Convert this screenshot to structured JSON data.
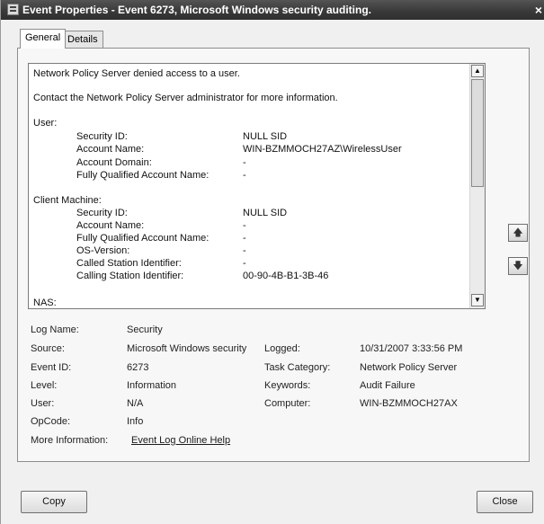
{
  "window": {
    "title": "Event Properties - Event 6273, Microsoft Windows security auditing.",
    "close_glyph": "×"
  },
  "tabs": [
    {
      "label": "General",
      "active": true
    },
    {
      "label": "Details",
      "active": false
    }
  ],
  "description": {
    "summary": "Network Policy Server denied access to a user.",
    "contact": "Contact the Network Policy Server administrator for more information.",
    "sections": [
      {
        "heading": "User:",
        "fields": [
          {
            "label": "Security ID:",
            "value": "NULL SID"
          },
          {
            "label": "Account Name:",
            "value": "WIN-BZMMOCH27AZ\\WirelessUser"
          },
          {
            "label": "Account Domain:",
            "value": "-"
          },
          {
            "label": "Fully Qualified Account Name:",
            "value": "-"
          }
        ]
      },
      {
        "heading": "Client Machine:",
        "fields": [
          {
            "label": "Security ID:",
            "value": "NULL SID"
          },
          {
            "label": "Account Name:",
            "value": "-"
          },
          {
            "label": "Fully Qualified Account Name:",
            "value": "-"
          },
          {
            "label": "OS-Version:",
            "value": "-"
          },
          {
            "label": "Called Station Identifier:",
            "value": "-"
          },
          {
            "label": "Calling Station Identifier:",
            "value": "00-90-4B-B1-3B-46"
          }
        ]
      },
      {
        "heading": "NAS:",
        "fields": []
      }
    ]
  },
  "scrollbar": {
    "up_glyph": "▲",
    "down_glyph": "▼"
  },
  "side_buttons": {
    "up_glyph": "🡅",
    "down_glyph": "🡇"
  },
  "properties": {
    "log_name": {
      "label": "Log Name:",
      "value": "Security"
    },
    "source": {
      "label": "Source:",
      "value": "Microsoft Windows security"
    },
    "logged": {
      "label": "Logged:",
      "value": "10/31/2007 3:33:56 PM"
    },
    "event_id": {
      "label": "Event ID:",
      "value": "6273"
    },
    "task_category": {
      "label": "Task Category:",
      "value": "Network Policy Server"
    },
    "level": {
      "label": "Level:",
      "value": "Information"
    },
    "keywords": {
      "label": "Keywords:",
      "value": "Audit Failure"
    },
    "user": {
      "label": "User:",
      "value": "N/A"
    },
    "computer": {
      "label": "Computer:",
      "value": "WIN-BZMMOCH27AX"
    },
    "opcode": {
      "label": "OpCode:",
      "value": "Info"
    },
    "more_info": {
      "label": "More Information:",
      "value": "Event Log Online Help"
    }
  },
  "buttons": {
    "copy": "Copy",
    "close": "Close"
  }
}
